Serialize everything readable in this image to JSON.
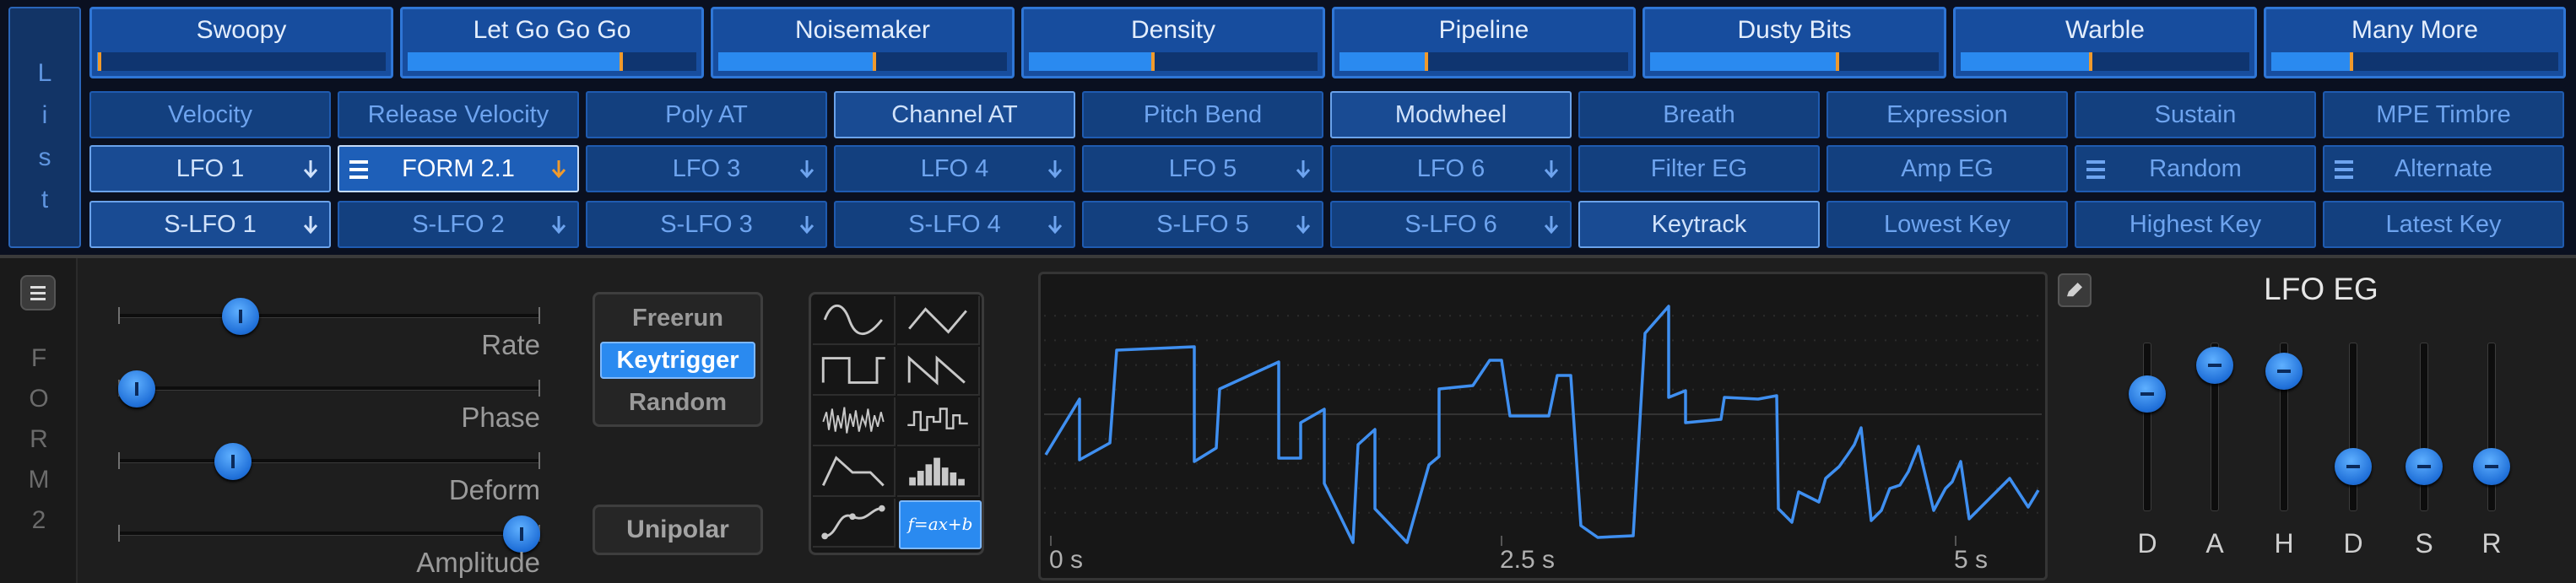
{
  "list_button": {
    "letters": [
      "L",
      "i",
      "s",
      "t"
    ]
  },
  "macros": [
    {
      "label": "Swoopy",
      "value": 0.01
    },
    {
      "label": "Let Go Go Go",
      "value": 0.74
    },
    {
      "label": "Noisemaker",
      "value": 0.54
    },
    {
      "label": "Density",
      "value": 0.43
    },
    {
      "label": "Pipeline",
      "value": 0.3
    },
    {
      "label": "Dusty Bits",
      "value": 0.65
    },
    {
      "label": "Warble",
      "value": 0.45
    },
    {
      "label": "Many More",
      "value": 0.28
    }
  ],
  "sources": {
    "row1": [
      {
        "label": "Velocity",
        "style": "dim"
      },
      {
        "label": "Release Velocity",
        "style": "dim"
      },
      {
        "label": "Poly AT",
        "style": "dim"
      },
      {
        "label": "Channel AT",
        "style": "bright"
      },
      {
        "label": "Pitch Bend",
        "style": "dim"
      },
      {
        "label": "Modwheel",
        "style": "bright"
      },
      {
        "label": "Breath",
        "style": "dim"
      },
      {
        "label": "Expression",
        "style": "dim"
      },
      {
        "label": "Sustain",
        "style": "dim"
      },
      {
        "label": "MPE Timbre",
        "style": "dim"
      }
    ],
    "row2": [
      {
        "label": "LFO 1",
        "style": "bright",
        "arrow": true
      },
      {
        "label": "FORM 2.1",
        "style": "sel",
        "arrow": true,
        "menu": true
      },
      {
        "label": "LFO 3",
        "style": "dim",
        "arrow": true
      },
      {
        "label": "LFO 4",
        "style": "dim",
        "arrow": true
      },
      {
        "label": "LFO 5",
        "style": "dim",
        "arrow": true
      },
      {
        "label": "LFO 6",
        "style": "dim",
        "arrow": true
      },
      {
        "label": "Filter EG",
        "style": "dim"
      },
      {
        "label": "Amp EG",
        "style": "dim"
      },
      {
        "label": "Random",
        "style": "dim",
        "menu": true
      },
      {
        "label": "Alternate",
        "style": "dim",
        "menu": true
      }
    ],
    "row3": [
      {
        "label": "S-LFO 1",
        "style": "bright",
        "arrow": true
      },
      {
        "label": "S-LFO 2",
        "style": "dim",
        "arrow": true
      },
      {
        "label": "S-LFO 3",
        "style": "dim",
        "arrow": true
      },
      {
        "label": "S-LFO 4",
        "style": "dim",
        "arrow": true
      },
      {
        "label": "S-LFO 5",
        "style": "dim",
        "arrow": true
      },
      {
        "label": "S-LFO 6",
        "style": "dim",
        "arrow": true
      },
      {
        "label": "Keytrack",
        "style": "bright"
      },
      {
        "label": "Lowest Key",
        "style": "dim"
      },
      {
        "label": "Highest Key",
        "style": "dim"
      },
      {
        "label": "Latest Key",
        "style": "dim"
      }
    ]
  },
  "device": {
    "name_letters": [
      "F",
      "O",
      "R",
      "M",
      "2"
    ],
    "sliders": [
      {
        "label": "Rate",
        "value": 0.27
      },
      {
        "label": "Phase",
        "value": 0.0
      },
      {
        "label": "Deform",
        "value": 0.25
      },
      {
        "label": "Amplitude",
        "value": 1.0
      }
    ],
    "modes": [
      {
        "label": "Freerun",
        "active": false
      },
      {
        "label": "Keytrigger",
        "active": true
      },
      {
        "label": "Random",
        "active": false
      }
    ],
    "unipolar_label": "Unipolar",
    "shapes": [
      {
        "icon": "sine-wave-icon"
      },
      {
        "icon": "triangle-wave-icon"
      },
      {
        "icon": "square-wave-icon"
      },
      {
        "icon": "sawtooth-wave-icon"
      },
      {
        "icon": "noise-wave-icon"
      },
      {
        "icon": "sample-hold-wave-icon"
      },
      {
        "icon": "envelope-shape-icon"
      },
      {
        "icon": "step-sequence-icon"
      },
      {
        "icon": "curve-shape-icon"
      },
      {
        "icon": "formula-icon",
        "text": "f=ax+b",
        "active": true
      }
    ],
    "scope": {
      "time_labels": [
        "0 s",
        "2.5 s",
        "5 s"
      ],
      "line_color": "#3f8ff0"
    },
    "envelope": {
      "title": "LFO EG",
      "faders": [
        {
          "label": "D",
          "value": 0.75
        },
        {
          "label": "A",
          "value": 0.97
        },
        {
          "label": "H",
          "value": 0.92
        },
        {
          "label": "D",
          "value": 0.2
        },
        {
          "label": "S",
          "value": 0.2
        },
        {
          "label": "R",
          "value": 0.2
        }
      ]
    }
  },
  "colors": {
    "accent": "#2a8af0",
    "marker": "#f09a2c"
  }
}
